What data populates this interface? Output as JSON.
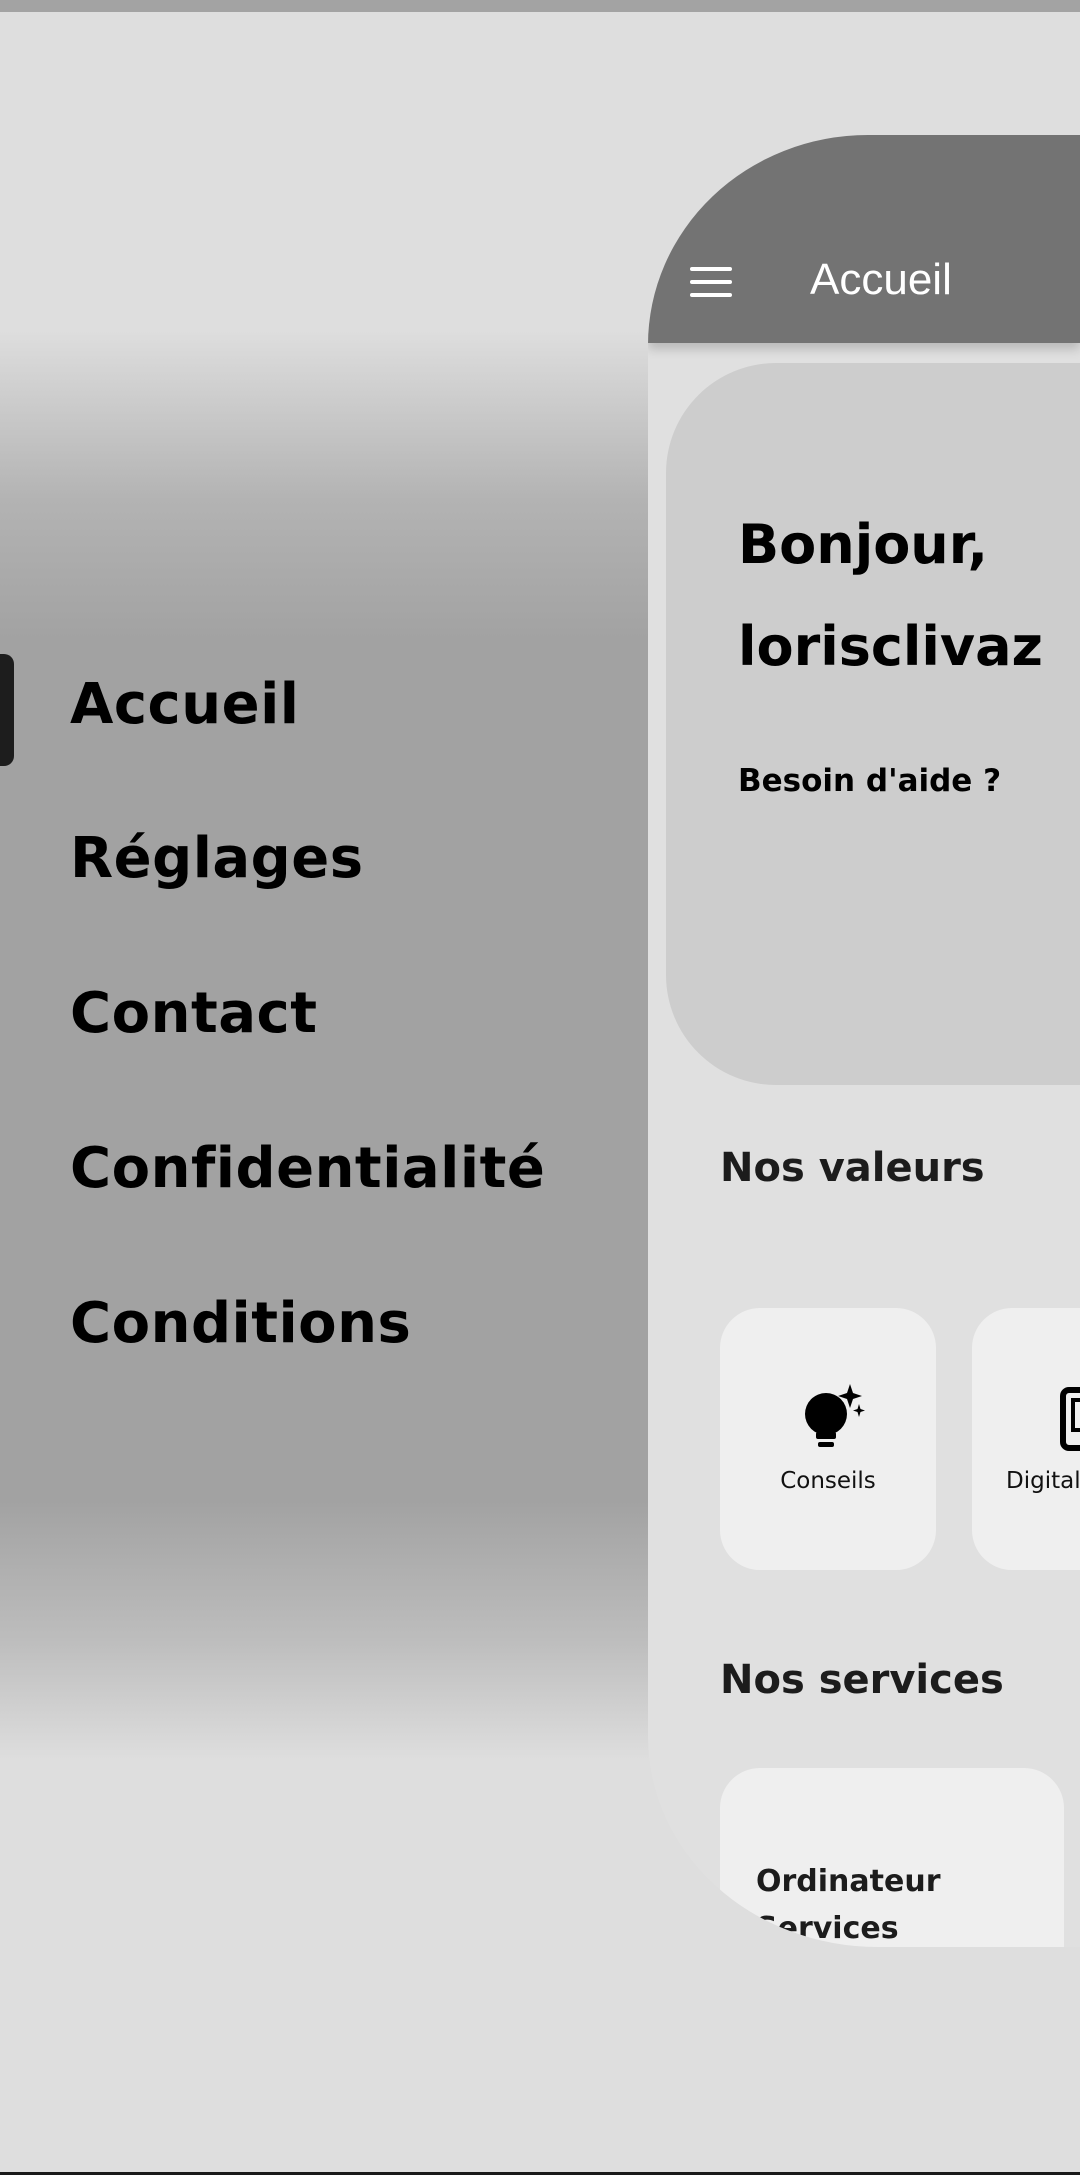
{
  "drawer": {
    "items": [
      {
        "label": "Accueil"
      },
      {
        "label": "Réglages"
      },
      {
        "label": "Contact"
      },
      {
        "label": "Confidentialité"
      },
      {
        "label": "Conditions"
      }
    ],
    "selected": "Accueil"
  },
  "app": {
    "title": "Accueil",
    "hero": {
      "greeting_line1": "Bonjour,",
      "greeting_line2": "lorisclivaz",
      "help_label": "Besoin d'aide ?"
    },
    "values_section": {
      "title": "Nos valeurs",
      "cards": [
        {
          "label": "Conseils",
          "icon": "lightbulb-sparkle-icon"
        },
        {
          "label": "Digital",
          "icon": "tablet-icon"
        }
      ]
    },
    "services_section": {
      "title": "Nos services",
      "cards": [
        {
          "title": "Ordinateur Services"
        }
      ]
    }
  },
  "colors": {
    "app_bar": "#737373",
    "hero_card": "#cdcdcd",
    "panel_bg": "#e0e0e0",
    "card_bg": "#efefef",
    "drawer_indicator": "#1d1d1d"
  }
}
